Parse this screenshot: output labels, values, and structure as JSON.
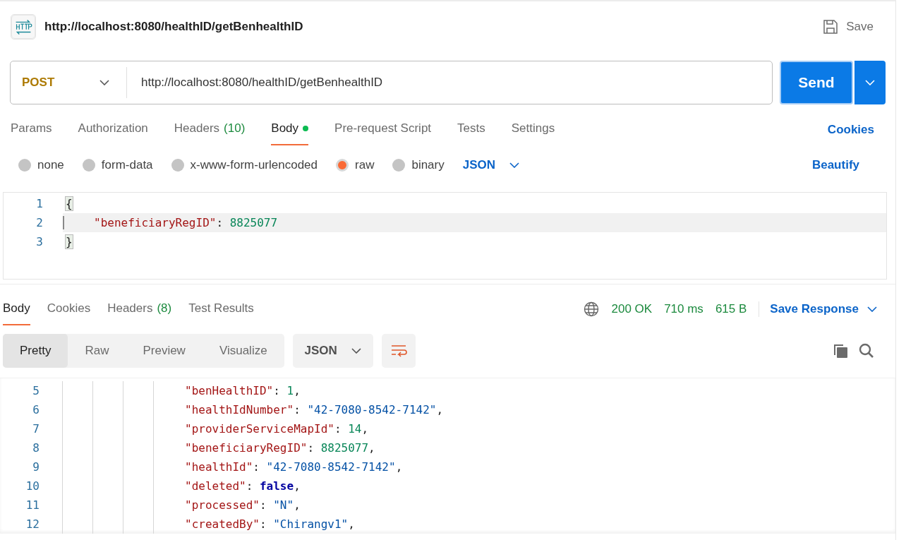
{
  "request": {
    "title": "http://localhost:8080/healthID/getBenhealthID",
    "save_label": "Save",
    "method": "POST",
    "url": "http://localhost:8080/healthID/getBenhealthID",
    "send_label": "Send"
  },
  "request_tabs": [
    {
      "label": "Params",
      "selected": false,
      "dot": false
    },
    {
      "label": "Authorization",
      "selected": false,
      "dot": false
    },
    {
      "label": "Headers",
      "count": "(10)",
      "selected": false,
      "dot": false
    },
    {
      "label": "Body",
      "selected": true,
      "dot": true
    },
    {
      "label": "Pre-request Script",
      "selected": false,
      "dot": false
    },
    {
      "label": "Tests",
      "selected": false,
      "dot": false
    },
    {
      "label": "Settings",
      "selected": false,
      "dot": false
    }
  ],
  "cookies_link": "Cookies",
  "body_types": [
    {
      "label": "none",
      "selected": false
    },
    {
      "label": "form-data",
      "selected": false
    },
    {
      "label": "x-www-form-urlencoded",
      "selected": false
    },
    {
      "label": "raw",
      "selected": true
    },
    {
      "label": "binary",
      "selected": false
    }
  ],
  "body_format": "JSON",
  "beautify_label": "Beautify",
  "request_body": [
    {
      "number": "1",
      "indent": false,
      "tokens": [
        {
          "kind": "brace",
          "text": "{"
        }
      ]
    },
    {
      "number": "2",
      "indent": true,
      "tokens": [
        {
          "kind": "key",
          "text": "\"beneficiaryRegID\""
        },
        {
          "kind": "punct",
          "text": ": "
        },
        {
          "kind": "number",
          "text": "8825077"
        }
      ]
    },
    {
      "number": "3",
      "indent": false,
      "tokens": [
        {
          "kind": "brace",
          "text": "}"
        }
      ]
    }
  ],
  "response_tabs": [
    {
      "label": "Body",
      "selected": true
    },
    {
      "label": "Cookies",
      "selected": false
    },
    {
      "label": "Headers",
      "count": "(8)",
      "selected": false
    },
    {
      "label": "Test Results",
      "selected": false
    }
  ],
  "status": {
    "code": "200 OK",
    "time": "710 ms",
    "size": "615 B",
    "save_label": "Save Response"
  },
  "view_modes": [
    {
      "label": "Pretty",
      "selected": true
    },
    {
      "label": "Raw",
      "selected": false
    },
    {
      "label": "Preview",
      "selected": false
    },
    {
      "label": "Visualize",
      "selected": false
    }
  ],
  "response_format": "JSON",
  "response_body": [
    {
      "number": "5",
      "tokens": [
        {
          "kind": "key",
          "text": "\"benHealthID\""
        },
        {
          "kind": "punct",
          "text": ": "
        },
        {
          "kind": "number",
          "text": "1"
        },
        {
          "kind": "punct",
          "text": ","
        }
      ]
    },
    {
      "number": "6",
      "tokens": [
        {
          "kind": "key",
          "text": "\"healthIdNumber\""
        },
        {
          "kind": "punct",
          "text": ": "
        },
        {
          "kind": "string",
          "text": "\"42-7080-8542-7142\""
        },
        {
          "kind": "punct",
          "text": ","
        }
      ]
    },
    {
      "number": "7",
      "tokens": [
        {
          "kind": "key",
          "text": "\"providerServiceMapId\""
        },
        {
          "kind": "punct",
          "text": ": "
        },
        {
          "kind": "number",
          "text": "14"
        },
        {
          "kind": "punct",
          "text": ","
        }
      ]
    },
    {
      "number": "8",
      "tokens": [
        {
          "kind": "key",
          "text": "\"beneficiaryRegID\""
        },
        {
          "kind": "punct",
          "text": ": "
        },
        {
          "kind": "number",
          "text": "8825077"
        },
        {
          "kind": "punct",
          "text": ","
        }
      ]
    },
    {
      "number": "9",
      "tokens": [
        {
          "kind": "key",
          "text": "\"healthId\""
        },
        {
          "kind": "punct",
          "text": ": "
        },
        {
          "kind": "string",
          "text": "\"42-7080-8542-7142\""
        },
        {
          "kind": "punct",
          "text": ","
        }
      ]
    },
    {
      "number": "10",
      "tokens": [
        {
          "kind": "key",
          "text": "\"deleted\""
        },
        {
          "kind": "punct",
          "text": ": "
        },
        {
          "kind": "boolean",
          "text": "false"
        },
        {
          "kind": "punct",
          "text": ","
        }
      ]
    },
    {
      "number": "11",
      "tokens": [
        {
          "kind": "key",
          "text": "\"processed\""
        },
        {
          "kind": "punct",
          "text": ": "
        },
        {
          "kind": "string",
          "text": "\"N\""
        },
        {
          "kind": "punct",
          "text": ","
        }
      ]
    },
    {
      "number": "12",
      "tokens": [
        {
          "kind": "key",
          "text": "\"createdBy\""
        },
        {
          "kind": "punct",
          "text": ": "
        },
        {
          "kind": "string",
          "text": "\"Chirangv1\""
        },
        {
          "kind": "punct",
          "text": ","
        }
      ]
    }
  ]
}
